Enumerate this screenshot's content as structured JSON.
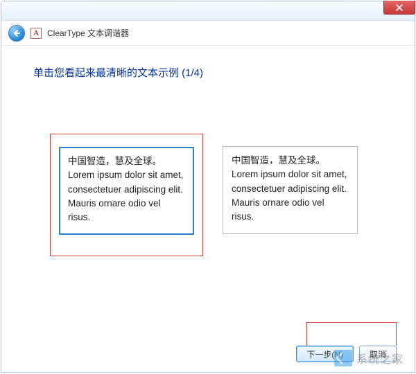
{
  "window": {
    "app_title": "ClearType 文本调谐器",
    "icon_letter": "A"
  },
  "heading": "单击您看起来最清晰的文本示例 (1/4)",
  "samples": [
    {
      "text": "中国智造，慧及全球。\nLorem ipsum dolor sit amet, consectetuer adipiscing elit. Mauris ornare odio vel risus.",
      "selected": true
    },
    {
      "text": "中国智造，慧及全球。\nLorem ipsum dolor sit amet, consectetuer adipiscing elit. Mauris ornare odio vel risus.",
      "selected": false
    }
  ],
  "buttons": {
    "next": "下一步(N)",
    "cancel": "取消"
  },
  "watermark": "系统之家"
}
